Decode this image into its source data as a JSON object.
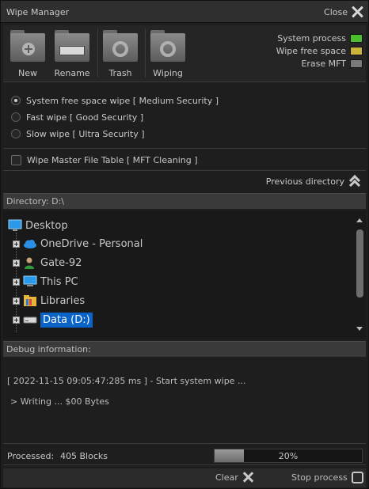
{
  "window": {
    "title": "Wipe Manager",
    "close_label": "Close"
  },
  "toolbar": {
    "buttons": [
      {
        "label": "New",
        "icon": "new-folder-icon"
      },
      {
        "label": "Rename",
        "icon": "rename-folder-icon"
      },
      {
        "label": "Trash",
        "icon": "trash-folder-icon"
      },
      {
        "label": "Wiping",
        "icon": "wiping-folder-icon"
      }
    ],
    "legend": [
      {
        "label": "System process",
        "color": "#4cbf2f"
      },
      {
        "label": "Wipe free space",
        "color": "#c9b53a"
      },
      {
        "label": "Erase MFT",
        "color": "#7a7a7a"
      }
    ]
  },
  "options": {
    "radios": [
      {
        "label": "System free space wipe [ Medium Security ]",
        "selected": true
      },
      {
        "label": "Fast wipe [ Good Security ]",
        "selected": false
      },
      {
        "label": "Slow wipe [ Ultra Security ]",
        "selected": false
      }
    ],
    "checkbox": {
      "label": "Wipe Master File Table [ MFT Cleaning ]",
      "checked": false
    }
  },
  "nav": {
    "previous_label": "Previous directory"
  },
  "directory": {
    "label": "Directory:  D:\\"
  },
  "tree": {
    "root": {
      "label": "Desktop",
      "icon": "desktop-icon"
    },
    "items": [
      {
        "label": "OneDrive - Personal",
        "icon": "onedrive-cloud-icon"
      },
      {
        "label": "Gate-92",
        "icon": "user-icon"
      },
      {
        "label": "This PC",
        "icon": "computer-icon"
      },
      {
        "label": "Libraries",
        "icon": "libraries-folder-icon"
      },
      {
        "label": "Data (D:)",
        "icon": "drive-icon",
        "selected": true
      }
    ]
  },
  "debug": {
    "header": "Debug information:",
    "lines": [
      "[ 2022-11-15  09:05:47:285 ms ] - Start system wipe ...",
      "> Writing ... $00 Bytes"
    ]
  },
  "status": {
    "processed_label": "Processed:",
    "processed_value": "405 Blocks",
    "progress_text": "20%",
    "progress_fraction": 0.2
  },
  "actions": {
    "clear_label": "Clear",
    "stop_label": "Stop process"
  }
}
